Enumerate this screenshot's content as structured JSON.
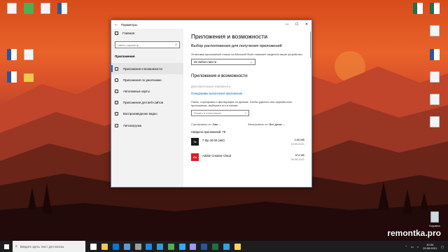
{
  "desktop": {
    "watermark": "remontka.pro",
    "icons_left": [
      {
        "caption": "",
        "kind": "file"
      },
      {
        "caption": "",
        "kind": "green"
      },
      {
        "caption": "",
        "kind": "file"
      },
      {
        "caption": "",
        "kind": "word"
      },
      {
        "caption": "",
        "kind": "word"
      },
      {
        "caption": "",
        "kind": "file"
      },
      {
        "caption": "",
        "kind": "word"
      },
      {
        "caption": "",
        "kind": "folder"
      }
    ],
    "icons_right": [
      {
        "caption": "",
        "kind": "excel"
      },
      {
        "caption": "",
        "kind": "excel"
      },
      {
        "caption": "",
        "kind": "file"
      },
      {
        "caption": "",
        "kind": "word"
      },
      {
        "caption": "",
        "kind": "file"
      },
      {
        "caption": "",
        "kind": "file"
      },
      {
        "caption": "",
        "kind": "file"
      },
      {
        "caption": "Корзина",
        "kind": "trash"
      }
    ]
  },
  "window": {
    "title": "Параметры",
    "back_glyph": "←",
    "minimize_glyph": "—",
    "maximize_glyph": "☐",
    "close_glyph": "✕"
  },
  "sidebar": {
    "home": "Главная",
    "search_placeholder": "Найти параметр",
    "section": "Приложения",
    "items": [
      {
        "label": "Приложения и возможности",
        "active": true
      },
      {
        "label": "Приложения по умолчанию",
        "active": false
      },
      {
        "label": "Автономные карты",
        "active": false
      },
      {
        "label": "Приложения для веб-сайтов",
        "active": false
      },
      {
        "label": "Воспроизведение видео",
        "active": false
      },
      {
        "label": "Автозагрузка",
        "active": false
      }
    ]
  },
  "content": {
    "page_title": "Приложения и возможности",
    "install_heading": "Выбор расположения для получения приложений",
    "install_desc": "Установка приложений только из Microsoft Store помогает защитить ваше устройство.",
    "install_dropdown": "Из любого места",
    "apps_heading": "Приложения и возможности",
    "optional_features": "Дополнительные компоненты",
    "app_aliases": "Псевдонимы выполнения приложения",
    "search_desc": "Поиск, сортировка и фильтрация по дискам. Чтобы удалить или переместить приложение, выберите его в списке.",
    "list_search_placeholder": "Искать в этом списке",
    "sort_label": "Сортировать по:",
    "sort_value": "Имя",
    "filter_label": "Фильтровать по:",
    "filter_value": "Все диски",
    "found": "Найдено приложений: 79",
    "apps": [
      {
        "name": "7-Zip 19.00 (x64)",
        "size": "4,96 МБ",
        "date": "19.05.2021",
        "icon_text": "7z",
        "icon_color": "#1a1a1a"
      },
      {
        "name": "Adobe Creative Cloud",
        "size": "574 МБ",
        "date": "30.06.2021",
        "icon_text": "Cc",
        "icon_color": "#da1f26"
      }
    ]
  },
  "taskbar": {
    "search_placeholder": "Введите здесь текст для поиска",
    "time": "10:04",
    "date": "23.08.2021",
    "icons": [
      {
        "name": "task-view-icon",
        "color": "#ffffff"
      },
      {
        "name": "explorer-icon",
        "color": "#f2c94c"
      },
      {
        "name": "mail-icon",
        "color": "#0078d7"
      },
      {
        "name": "store-icon",
        "color": "#5b9bd5"
      },
      {
        "name": "settings-icon",
        "color": "#9e9e9e"
      },
      {
        "name": "vscode-icon",
        "color": "#1e88e5"
      },
      {
        "name": "edge-icon",
        "color": "#2e9ed6"
      },
      {
        "name": "chrome-icon",
        "color": "#4caf50"
      },
      {
        "name": "photoshop-icon",
        "color": "#31a8ff"
      },
      {
        "name": "premiere-icon",
        "color": "#9999ff"
      },
      {
        "name": "word-icon",
        "color": "#2b579a"
      },
      {
        "name": "excel-icon",
        "color": "#1e7145"
      },
      {
        "name": "telegram-icon",
        "color": "#2ca5e0"
      },
      {
        "name": "notes-icon",
        "color": "#ffd54f"
      }
    ]
  }
}
